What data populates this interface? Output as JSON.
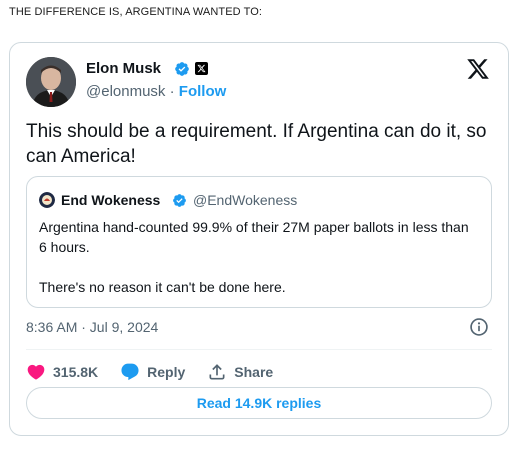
{
  "caption": "THE DIFFERENCE IS, ARGENTINA WANTED TO:",
  "tweet": {
    "author_name": "Elon Musk",
    "author_handle": "@elonmusk",
    "separator": " · ",
    "follow_label": "Follow",
    "text": "This should be a requirement. If Argentina can do it, so can America!",
    "timestamp": "8:36 AM · Jul 9, 2024",
    "likes": "315.8K",
    "reply_label": "Reply",
    "share_label": "Share",
    "read_replies": "Read 14.9K replies"
  },
  "quote": {
    "author_name": "End Wokeness",
    "author_handle": "@EndWokeness",
    "line1": "Argentina hand-counted 99.9% of their 27M paper ballots in less than 6 hours.",
    "line2": "There's no reason it can't be done here."
  },
  "colors": {
    "accent": "#1d9bf0",
    "like": "#f91880",
    "secondary_text": "#536471",
    "border": "#cfd9de"
  },
  "icons": [
    "verified-badge-icon",
    "x-logo-icon",
    "info-icon",
    "heart-icon",
    "reply-bubble-icon",
    "share-icon"
  ]
}
